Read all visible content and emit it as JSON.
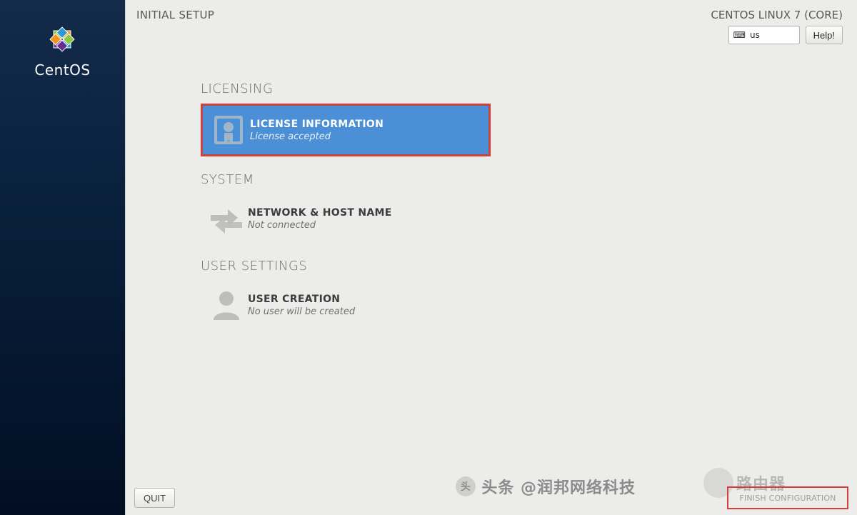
{
  "sidebar": {
    "brand": "CentOS"
  },
  "header": {
    "title": "INITIAL SETUP",
    "distro": "CENTOS LINUX 7 (CORE)",
    "keyboard_layout": "us",
    "help_label": "Help!"
  },
  "sections": {
    "licensing": {
      "label": "LICENSING",
      "spoke": {
        "title": "LICENSE INFORMATION",
        "status": "License accepted"
      }
    },
    "system": {
      "label": "SYSTEM",
      "spoke": {
        "title": "NETWORK & HOST NAME",
        "status": "Not connected"
      }
    },
    "user_settings": {
      "label": "USER SETTINGS",
      "spoke": {
        "title": "USER CREATION",
        "status": "No user will be created"
      }
    }
  },
  "footer": {
    "quit_label": "QUIT",
    "finish_label": "FINISH CONFIGURATION"
  },
  "watermarks": {
    "left": "头条 @润邦网络科技",
    "right": "路由器"
  }
}
